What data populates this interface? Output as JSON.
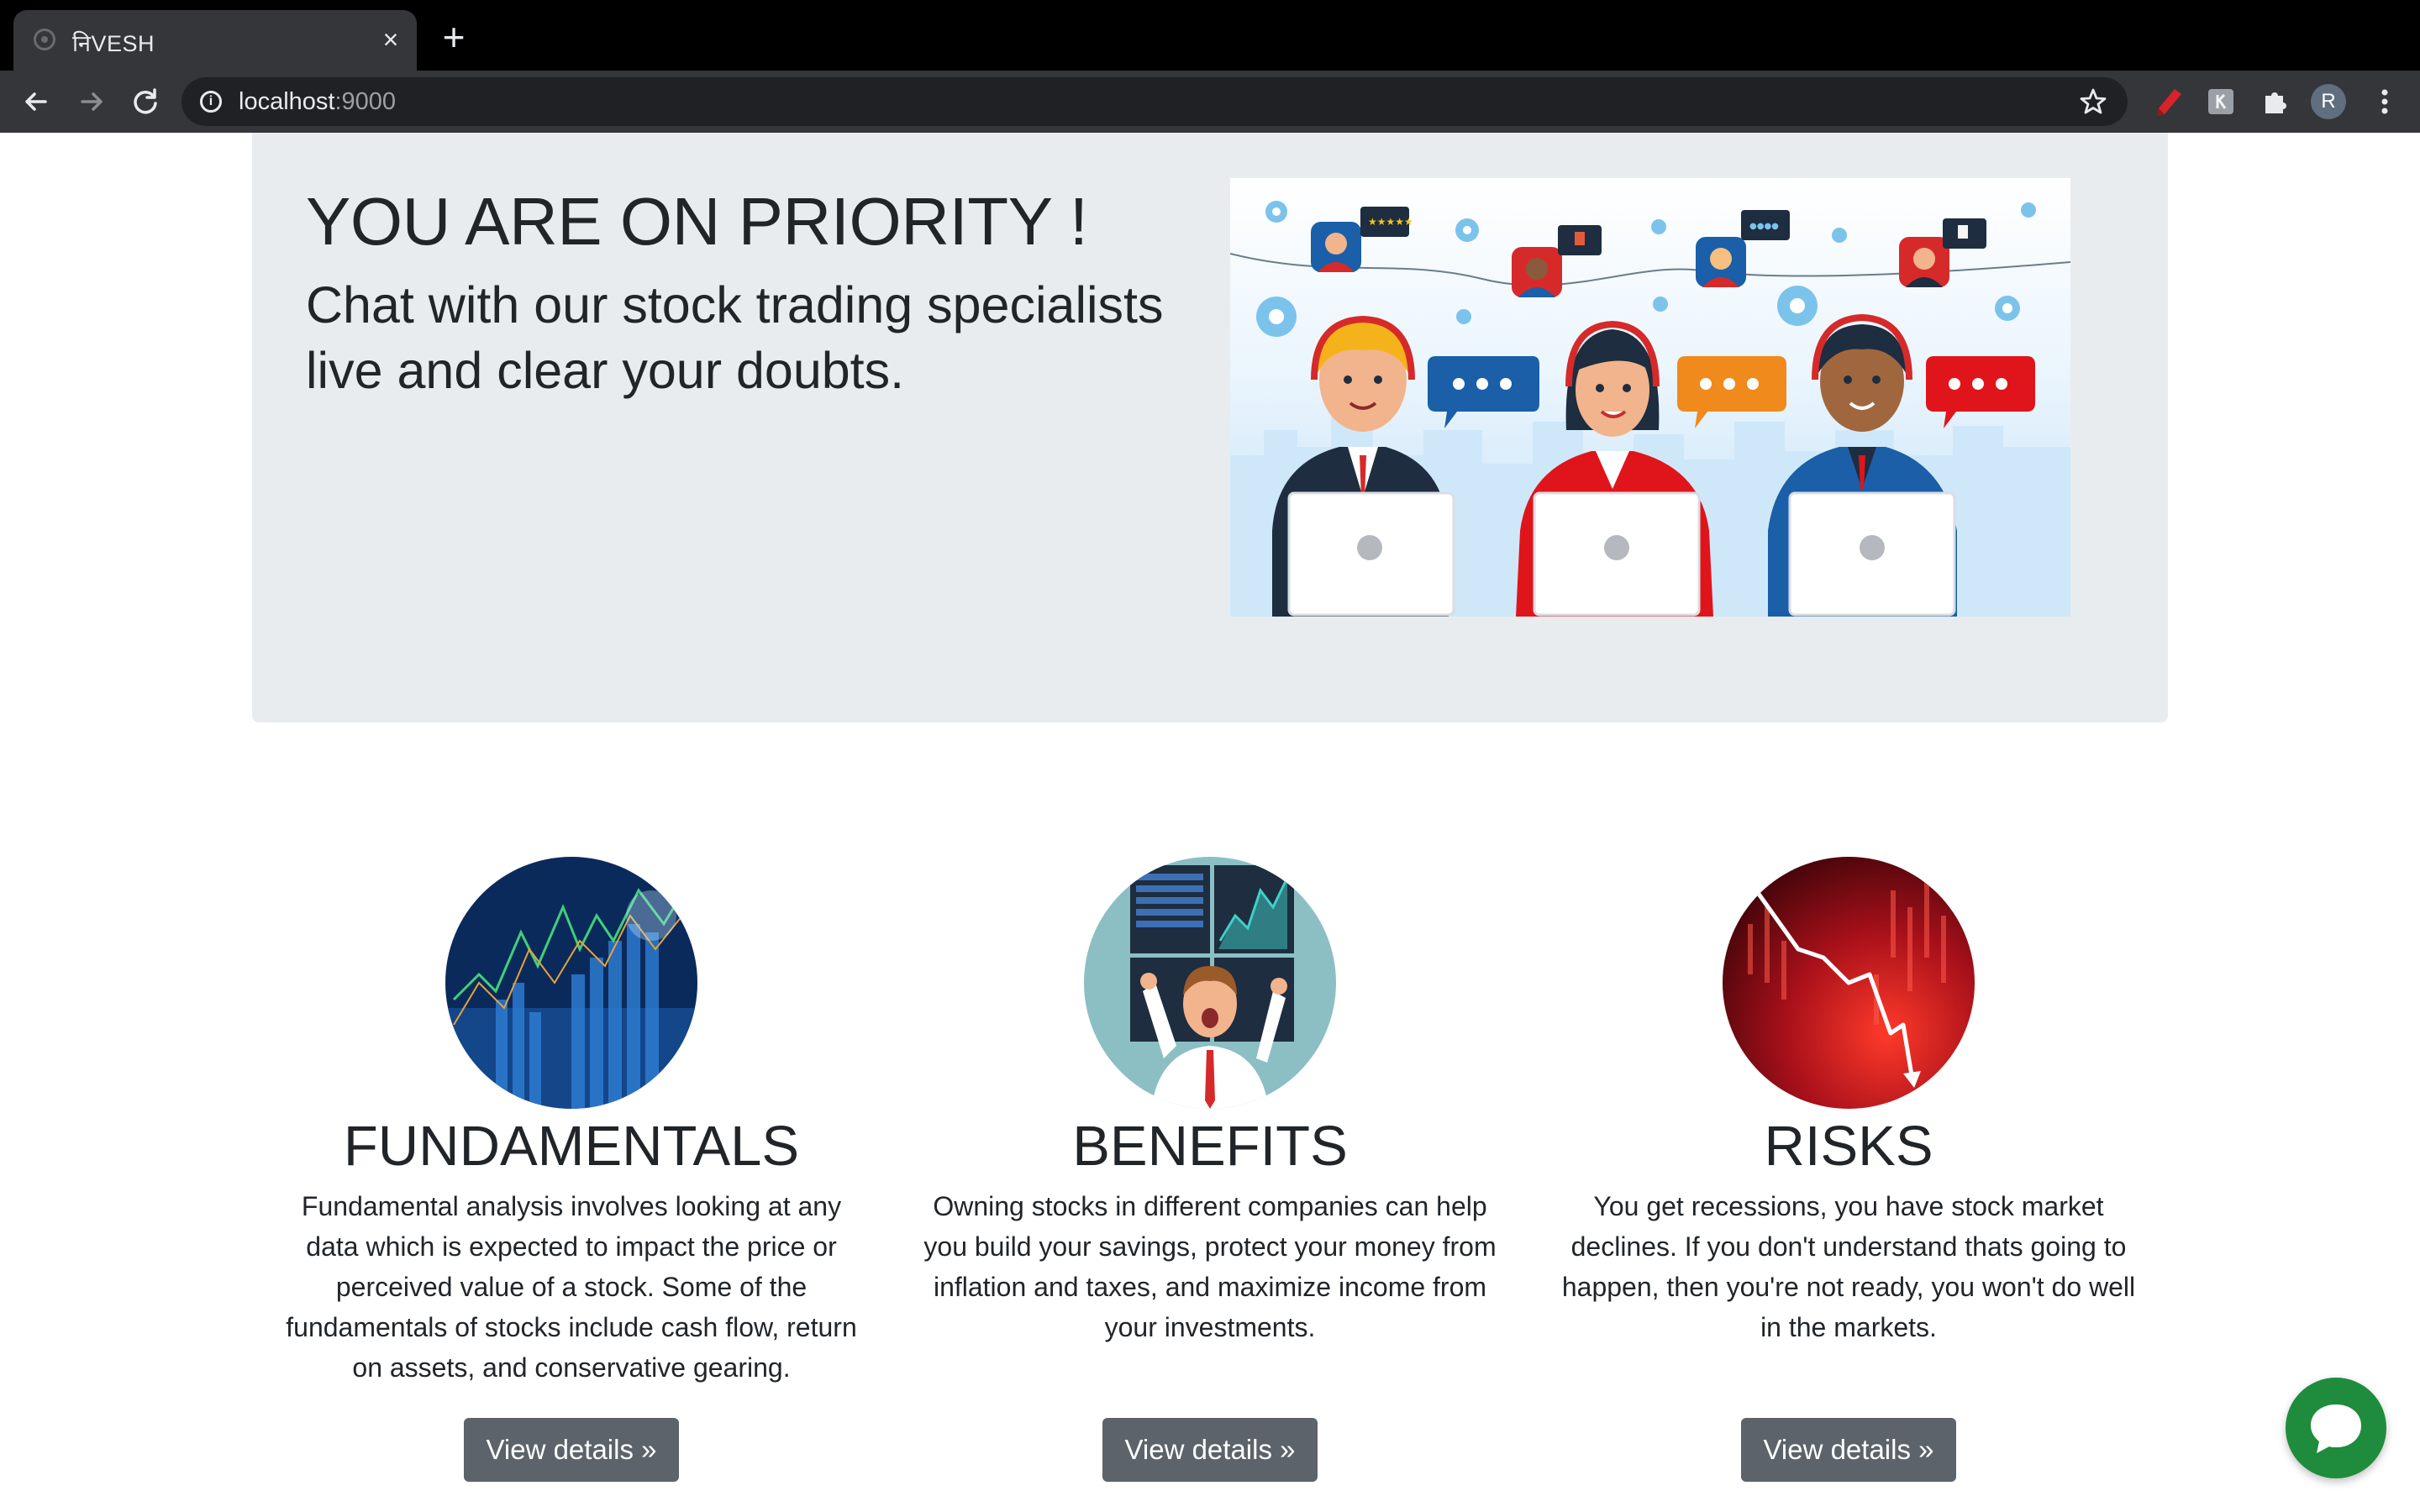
{
  "browser": {
    "tab_title": "निVESH",
    "tab_close": "×",
    "new_tab": "+",
    "url_host": "localhost",
    "url_port": ":9000",
    "profile_initial": "R"
  },
  "hero": {
    "title": "YOU ARE ON PRIORITY !",
    "subtitle": "Chat with our stock trading specialists live and clear your doubts."
  },
  "features": [
    {
      "heading": "FUNDAMENTALS",
      "text": "Fundamental analysis involves looking at any data which is expected to impact the price or perceived value of a stock. Some of the fundamentals of stocks include cash flow, return on assets, and conservative gearing.",
      "button": "View details »"
    },
    {
      "heading": "BENEFITS",
      "text": "Owning stocks in different companies can help you build your savings, protect your money from inflation and taxes, and maximize income from your investments.",
      "button": "View details »"
    },
    {
      "heading": "RISKS",
      "text": "You get recessions, you have stock market declines. If you don't understand thats going to happen, then you're not ready, you won't do well in the markets.",
      "button": "View details »"
    }
  ],
  "colors": {
    "jumbotron_bg": "#e9ecef",
    "button_bg": "#5c636a",
    "chat_fab": "#1e8c3c"
  },
  "icons": [
    "back-arrow-icon",
    "forward-arrow-icon",
    "reload-icon",
    "info-icon",
    "star-icon",
    "pen-extension-icon",
    "extension-icon",
    "puzzle-icon",
    "more-vert-icon",
    "chat-bubble-icon"
  ]
}
